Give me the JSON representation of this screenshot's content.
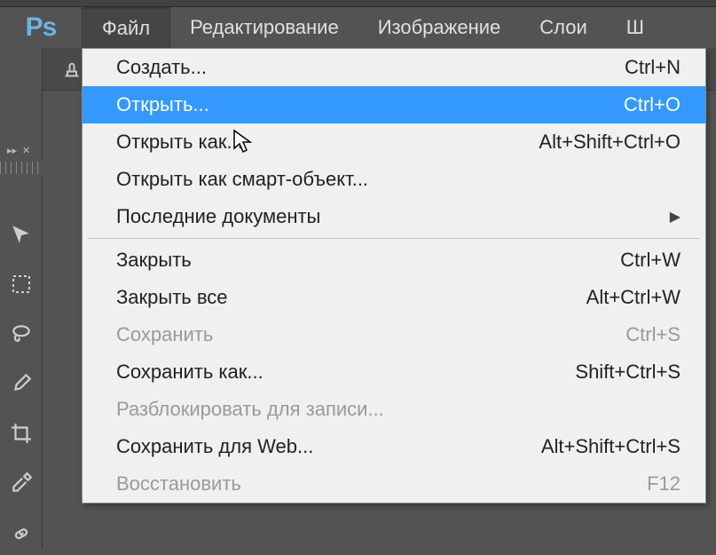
{
  "app": {
    "logo_text": "Ps"
  },
  "menubar": {
    "items": [
      {
        "label": "Файл",
        "active": true
      },
      {
        "label": "Редактирование",
        "active": false
      },
      {
        "label": "Изображение",
        "active": false
      },
      {
        "label": "Слои",
        "active": false
      },
      {
        "label": "Ш",
        "active": false
      }
    ]
  },
  "file_menu": {
    "groups": [
      [
        {
          "label": "Создать...",
          "shortcut": "Ctrl+N",
          "enabled": true,
          "submenu": false,
          "highlight": false
        },
        {
          "label": "Открыть...",
          "shortcut": "Ctrl+O",
          "enabled": true,
          "submenu": false,
          "highlight": true
        },
        {
          "label": "Открыть как...",
          "shortcut": "Alt+Shift+Ctrl+O",
          "enabled": true,
          "submenu": false,
          "highlight": false
        },
        {
          "label": "Открыть как смарт-объект...",
          "shortcut": "",
          "enabled": true,
          "submenu": false,
          "highlight": false
        },
        {
          "label": "Последние документы",
          "shortcut": "",
          "enabled": true,
          "submenu": true,
          "highlight": false
        }
      ],
      [
        {
          "label": "Закрыть",
          "shortcut": "Ctrl+W",
          "enabled": true,
          "submenu": false,
          "highlight": false
        },
        {
          "label": "Закрыть все",
          "shortcut": "Alt+Ctrl+W",
          "enabled": true,
          "submenu": false,
          "highlight": false
        },
        {
          "label": "Сохранить",
          "shortcut": "Ctrl+S",
          "enabled": false,
          "submenu": false,
          "highlight": false
        },
        {
          "label": "Сохранить как...",
          "shortcut": "Shift+Ctrl+S",
          "enabled": true,
          "submenu": false,
          "highlight": false
        },
        {
          "label": "Разблокировать для записи...",
          "shortcut": "",
          "enabled": false,
          "submenu": false,
          "highlight": false
        },
        {
          "label": "Сохранить для Web...",
          "shortcut": "Alt+Shift+Ctrl+S",
          "enabled": true,
          "submenu": false,
          "highlight": false
        },
        {
          "label": "Восстановить",
          "shortcut": "F12",
          "enabled": false,
          "submenu": false,
          "highlight": false
        }
      ]
    ]
  },
  "tools": [
    "move-tool",
    "marquee-tool",
    "lasso-tool",
    "brush-tool",
    "crop-tool",
    "eyedropper-tool",
    "healing-tool"
  ]
}
